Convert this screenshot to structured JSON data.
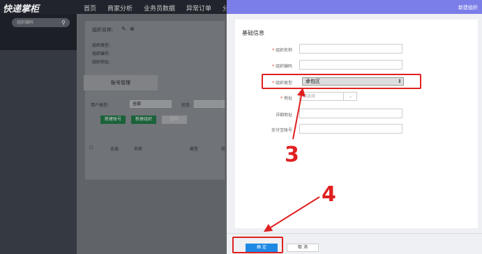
{
  "app": {
    "logo": "快递掌柜"
  },
  "nav": {
    "items": [
      "首页",
      "商家分析",
      "业务员数据",
      "异常订单",
      "分"
    ]
  },
  "search": {
    "placeholder": "组织编码"
  },
  "bg": {
    "org_name_label": "组织名称:",
    "org_type_label": "组织类型:",
    "org_code_label": "组织编号:",
    "org_addr_label": "组织地址:",
    "tab": "账号管理",
    "user_type_label": "用户类型:",
    "user_type_value": "全部",
    "status_label": "状态:",
    "btn_new_account": "新建账号",
    "btn_new_org": "新建组织",
    "btn_disabled": "删除",
    "col_all": "全选",
    "col_name": "名称",
    "col_type": "类型",
    "col_extra": "状"
  },
  "panel": {
    "title": "新建组织",
    "section": "基础信息",
    "fields": {
      "org_name": "组织名称",
      "org_code": "组织编码",
      "org_type": "组织类型",
      "org_type_value": "承包区",
      "address": "地址",
      "address_placeholder": "请选择",
      "detail_address": "详细地址",
      "alipay": "支付宝账号"
    },
    "ok": "确 定",
    "cancel": "取 消"
  },
  "annotations": {
    "step3": "3",
    "step4": "4"
  }
}
